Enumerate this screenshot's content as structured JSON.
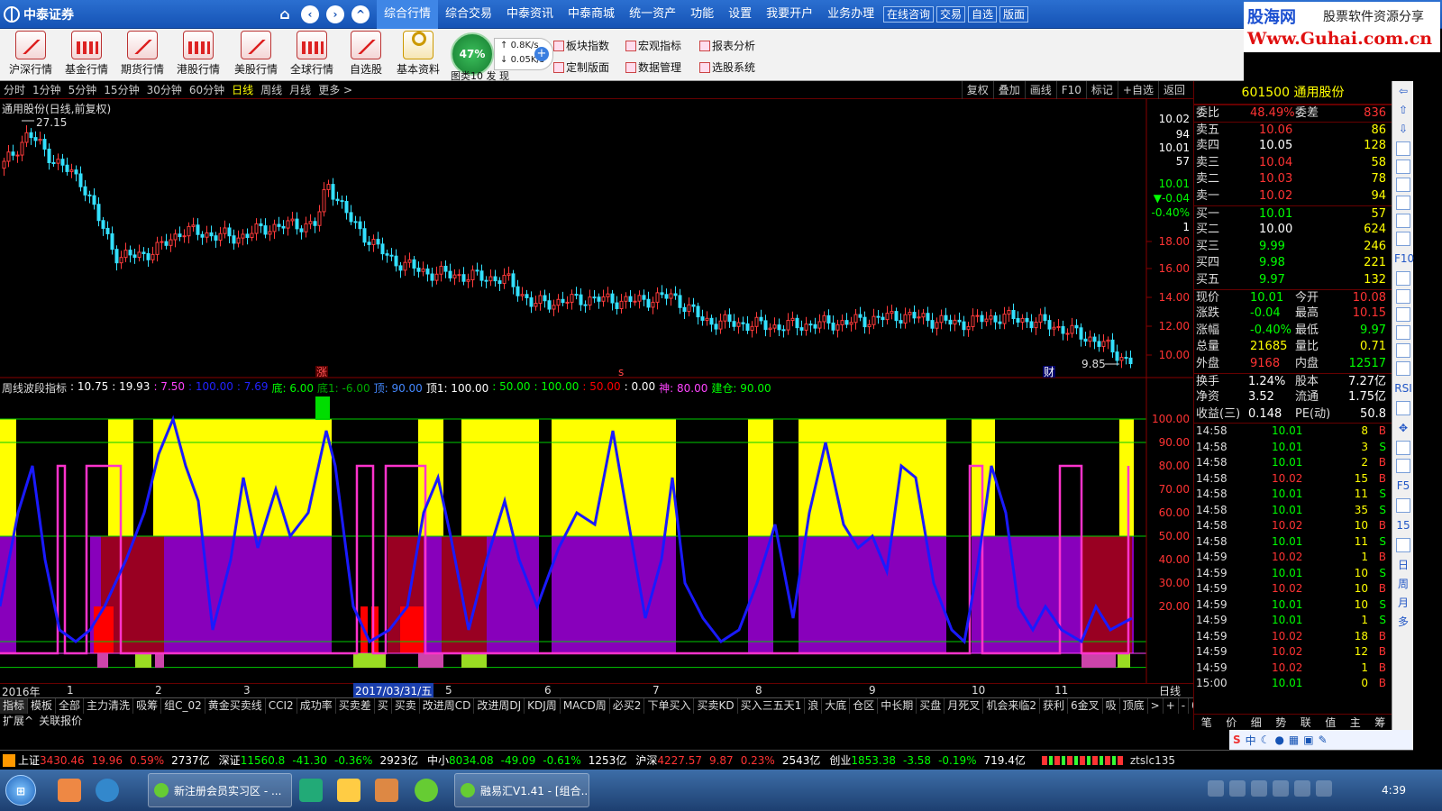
{
  "app": {
    "name": "中泰证券",
    "banner_title": "股海网",
    "banner_sub": "股票软件资源分享",
    "banner_url": "Www.Guhai.com.cn"
  },
  "menus": [
    "综合行情",
    "综合交易",
    "中泰资讯",
    "中泰商城",
    "统一资产",
    "功能",
    "设置",
    "我要开户",
    "业务办理"
  ],
  "quick_buttons": [
    "在线咨询",
    "交易",
    "自选",
    "版面"
  ],
  "tools": [
    "沪深行情",
    "基金行情",
    "期货行情",
    "港股行情",
    "美股行情",
    "全球行情",
    "自选股",
    "基本资料"
  ],
  "gauge": {
    "percent": "47%",
    "up": "0.8K/s",
    "down": "0.05K/s",
    "label": "图类10",
    "label2": "发  现"
  },
  "tool_links": [
    "板块指数",
    "宏观指标",
    "报表分析",
    "定制版面",
    "数据管理",
    "选股系统"
  ],
  "periods": [
    "分时",
    "1分钟",
    "5分钟",
    "15分钟",
    "30分钟",
    "60分钟",
    "日线",
    "周线",
    "月线",
    "更多 >"
  ],
  "right_tools": [
    "复权",
    "叠加",
    "画线",
    "F10",
    "标记",
    "+自选",
    "返回"
  ],
  "chart_title": "通用股份(日线,前复权)",
  "kline_labels": {
    "high": "27.15",
    "low": "9.85",
    "marker_zhang": "涨",
    "marker_s": "s",
    "marker_cai": "财"
  },
  "kline_axis": [
    "10.02",
    "94",
    "10.01",
    "57",
    "10.01",
    "▼-0.04",
    "-0.40%",
    "1",
    "18.00",
    "16.00",
    "14.00",
    "12.00",
    "10.00"
  ],
  "indicator": {
    "name": "周线波段指标",
    "legend": [
      {
        "t": ": 10.75",
        "c": "#ffffff"
      },
      {
        "t": ": 19.93",
        "c": "#ffffff"
      },
      {
        "t": ": 7.50",
        "c": "#ff44ff"
      },
      {
        "t": ": 100.00",
        "c": "#2222ff"
      },
      {
        "t": ": 7.69",
        "c": "#2222ff"
      },
      {
        "t": "底: 6.00",
        "c": "#00ff00"
      },
      {
        "t": "底1: -6.00",
        "c": "#00aa00"
      },
      {
        "t": "顶: 90.00",
        "c": "#4488ff"
      },
      {
        "t": "顶1: 100.00",
        "c": "#ffffff"
      },
      {
        "t": ": 50.00",
        "c": "#00ff00"
      },
      {
        "t": ": 100.00",
        "c": "#00ff00"
      },
      {
        "t": ": 50.00",
        "c": "#ff0000"
      },
      {
        "t": ": 0.00",
        "c": "#ffffff"
      },
      {
        "t": "神: 80.00",
        "c": "#ff44ff"
      },
      {
        "t": "建仓: 90.00",
        "c": "#00ff00"
      }
    ],
    "axis": [
      "100.00",
      "90.00",
      "80.00",
      "70.00",
      "60.00",
      "50.00",
      "40.00",
      "30.00",
      "20.00"
    ]
  },
  "date_axis": [
    "2016年",
    "1",
    "2",
    "3",
    "5",
    "6",
    "7",
    "8",
    "9",
    "10",
    "11"
  ],
  "date_box": "2017/03/31/五",
  "date_right": "日线",
  "ind_tabs": [
    "指标",
    "模板",
    "全部",
    "主力清洗",
    "吸筹",
    "组C_02",
    "黄金买卖线",
    "CCI2",
    "成功率",
    "买卖差",
    "买",
    "买卖",
    "改进周CD",
    "改进周DJ",
    "KDJ周",
    "MACD周",
    "必买2",
    "下单买入",
    "买卖KD",
    "买入三五天1",
    "浪",
    "大底",
    "仓区",
    "中长期",
    "买盘",
    "月死叉",
    "机会来临2",
    "获利",
    "6金叉",
    "吸",
    "顶底",
    ">",
    "+",
    "-",
    "0"
  ],
  "sub_tabs": [
    "扩展^",
    "关联报价"
  ],
  "stock": {
    "code": "601500",
    "name": "通用股份"
  },
  "quotes": {
    "weibi": {
      "label": "委比",
      "value": "48.49%",
      "label2": "委差",
      "value2": "836"
    },
    "sells": [
      {
        "label": "卖五",
        "price": "10.06",
        "vol": "86"
      },
      {
        "label": "卖四",
        "price": "10.05",
        "vol": "128"
      },
      {
        "label": "卖三",
        "price": "10.04",
        "vol": "58"
      },
      {
        "label": "卖二",
        "price": "10.03",
        "vol": "78"
      },
      {
        "label": "卖一",
        "price": "10.02",
        "vol": "94"
      }
    ],
    "buys": [
      {
        "label": "买一",
        "price": "10.01",
        "vol": "57"
      },
      {
        "label": "买二",
        "price": "10.00",
        "vol": "624"
      },
      {
        "label": "买三",
        "price": "9.99",
        "vol": "246"
      },
      {
        "label": "买四",
        "price": "9.98",
        "vol": "221"
      },
      {
        "label": "买五",
        "price": "9.97",
        "vol": "132"
      }
    ],
    "stats": [
      {
        "l1": "现价",
        "v1": "10.01",
        "c1": "#00ff00",
        "l2": "今开",
        "v2": "10.08",
        "c2": "#ff3333"
      },
      {
        "l1": "涨跌",
        "v1": "-0.04",
        "c1": "#00ff00",
        "l2": "最高",
        "v2": "10.15",
        "c2": "#ff3333"
      },
      {
        "l1": "涨幅",
        "v1": "-0.40%",
        "c1": "#00ff00",
        "l2": "最低",
        "v2": "9.97",
        "c2": "#00ff00"
      },
      {
        "l1": "总量",
        "v1": "21685",
        "c1": "#ffff00",
        "l2": "量比",
        "v2": "0.71",
        "c2": "#ffff00"
      },
      {
        "l1": "外盘",
        "v1": "9168",
        "c1": "#ff3333",
        "l2": "内盘",
        "v2": "12517",
        "c2": "#00ff00"
      }
    ],
    "stats2": [
      {
        "l1": "换手",
        "v1": "1.24%",
        "l2": "股本",
        "v2": "7.27亿"
      },
      {
        "l1": "净资",
        "v1": "3.52",
        "l2": "流通",
        "v2": "1.75亿"
      },
      {
        "l1": "收益(三)",
        "v1": "0.148",
        "l2": "PE(动)",
        "v2": "50.8"
      }
    ]
  },
  "ticks": [
    {
      "t": "14:58",
      "p": "10.01",
      "v": "8",
      "s": "B"
    },
    {
      "t": "14:58",
      "p": "10.01",
      "v": "3",
      "s": "S"
    },
    {
      "t": "14:58",
      "p": "10.01",
      "v": "2",
      "s": "B"
    },
    {
      "t": "14:58",
      "p": "10.02",
      "v": "15",
      "s": "B"
    },
    {
      "t": "14:58",
      "p": "10.01",
      "v": "11",
      "s": "S"
    },
    {
      "t": "14:58",
      "p": "10.01",
      "v": "35",
      "s": "S"
    },
    {
      "t": "14:58",
      "p": "10.02",
      "v": "10",
      "s": "B"
    },
    {
      "t": "14:58",
      "p": "10.01",
      "v": "11",
      "s": "S"
    },
    {
      "t": "14:59",
      "p": "10.02",
      "v": "1",
      "s": "B"
    },
    {
      "t": "14:59",
      "p": "10.01",
      "v": "10",
      "s": "S"
    },
    {
      "t": "14:59",
      "p": "10.02",
      "v": "10",
      "s": "B"
    },
    {
      "t": "14:59",
      "p": "10.01",
      "v": "10",
      "s": "S"
    },
    {
      "t": "14:59",
      "p": "10.01",
      "v": "1",
      "s": "S"
    },
    {
      "t": "14:59",
      "p": "10.02",
      "v": "18",
      "s": "B"
    },
    {
      "t": "14:59",
      "p": "10.02",
      "v": "12",
      "s": "B"
    },
    {
      "t": "14:59",
      "p": "10.02",
      "v": "1",
      "s": "B"
    },
    {
      "t": "15:00",
      "p": "10.01",
      "v": "0",
      "s": "B"
    }
  ],
  "panel_tabs": [
    "笔",
    "价",
    "细",
    "势",
    "联",
    "值",
    "主",
    "筹"
  ],
  "sidebar": [
    "⇦",
    "⇧",
    "⇩",
    "",
    "",
    "",
    "",
    "",
    "",
    "F10",
    "",
    "",
    "",
    "",
    "",
    "",
    "RSI",
    "",
    "✥",
    "",
    "",
    "F5",
    "",
    "15",
    "",
    "日",
    "周",
    "月",
    "多"
  ],
  "index_bar": [
    {
      "name": "上证",
      "val": "3430.46",
      "chg": "19.96",
      "pct": "0.59%",
      "amt": "2737亿",
      "up": true
    },
    {
      "name": "深证",
      "val": "11560.8",
      "chg": "-41.30",
      "pct": "-0.36%",
      "amt": "2923亿",
      "up": false
    },
    {
      "name": "中小",
      "val": "8034.08",
      "chg": "-49.09",
      "pct": "-0.61%",
      "amt": "1253亿",
      "up": false
    },
    {
      "name": "沪深",
      "val": "4227.57",
      "chg": "9.87",
      "pct": "0.23%",
      "amt": "2543亿",
      "up": true
    },
    {
      "name": "创业",
      "val": "1853.38",
      "chg": "-3.58",
      "pct": "-0.19%",
      "amt": "719.4亿",
      "up": false
    }
  ],
  "index_tail": "ztslc135",
  "taskbar": {
    "tasks": [
      "新注册会员实习区 - ...",
      "融易汇V1.41 - [组合..."
    ],
    "clock": "4:39"
  },
  "tray_text": "中"
}
